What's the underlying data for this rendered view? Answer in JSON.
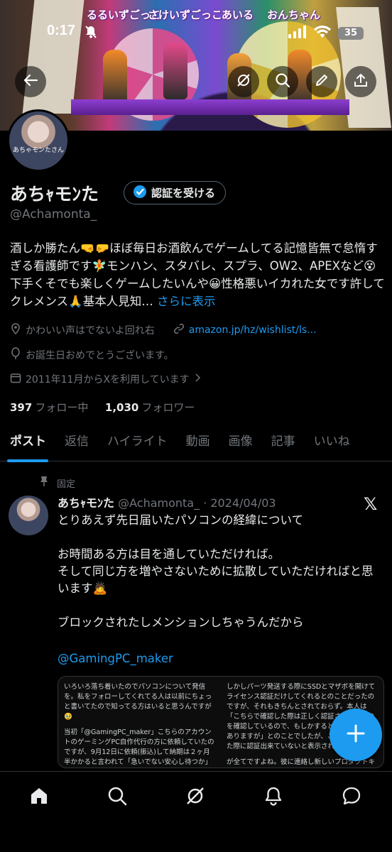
{
  "status": {
    "time": "0:17",
    "battery": "35"
  },
  "banner": {
    "labels": [
      "るるいずごっこ",
      "さけいずごっこ",
      "あいる",
      "おんちゃん"
    ]
  },
  "profile": {
    "name": "あちｬモﾝた",
    "verify_label": "認証を受ける",
    "handle": "@Achamonta_",
    "avatar_caption": "あちゃモンたさん",
    "bio_text": "酒しか勝たん🤜🤛ほぼ毎日お酒飲んでゲームしてる記憶皆無で怠惰すぎる看護師です🧚モンハン、スタバレ、スプラ、OW2、APEXなど😵下手くそでも楽しくゲームしたいんや😀性格悪いイカれた女です許してクレメンス🙏基本人見知…",
    "bio_more": "さらに表示",
    "location": "かわいい声はでないよ回れ右",
    "link": "amazon.jp/hz/wishlist/ls...",
    "birthday": "お誕生日おめでとうございます。",
    "joined": "2011年11月からXを利用しています",
    "following_count": "397",
    "following_label": "フォロー中",
    "followers_count": "1,030",
    "followers_label": "フォロワー"
  },
  "tabs": [
    "ポスト",
    "返信",
    "ハイライト",
    "動画",
    "画像",
    "記事",
    "いいね"
  ],
  "post": {
    "pinned_label": "固定",
    "author_name": "あちｬモﾝた",
    "author_meta": "@Achamonta_ · 2024/04/03",
    "lines": [
      "とりあえず先日届いたパソコンの経緯について",
      "",
      "お時間ある方は目を通していただければ。",
      "そして同じ方を増やさないために拡散していただければと思います🙇",
      "",
      "ブロックされたしメンションしちゃうんだから",
      ""
    ],
    "mention": "@GamingPC_maker",
    "image_left": [
      "いろいろ落ち着いたのでパソコンについて発信を。私をフォローしてくれてる人は以前にちょっと書いてたので知ってる方はいると思うんですが🥹",
      "当初「@GamingPC_maker」こちらのアカウントのゲーミングPC自作代行の方に依頼していたのですが、9月12日に依頼(振込)して納期は２ヶ月半かかると言われて「急いでない安心し待つか」ぐらいの気持ちでいたらまーまーまー！納期予定日近くなっても進捗連絡も来なければ納期過ぎても連絡こない。こちらから連絡して数日"
    ],
    "image_right": [
      "しかしパーツ発送する際にSSDとマザボを開けてライセンス認証だけしてくれるとのことだったのですが、それもきちんとされておらず。本人は「こちらで確認した際は正しく認証されていたのを確認しているので、もしかすると思うところはありますが」とのことでしたが、こちらでもらった際に認証出来ていないと表示されて",
      "が全てですよね。彼に連絡し新しいプロダクトキーを頂いたのですが到着後ライセンス認証は無事できていますが、そのようなトラブルもあったため、正直パーツ発送を確"
    ]
  }
}
